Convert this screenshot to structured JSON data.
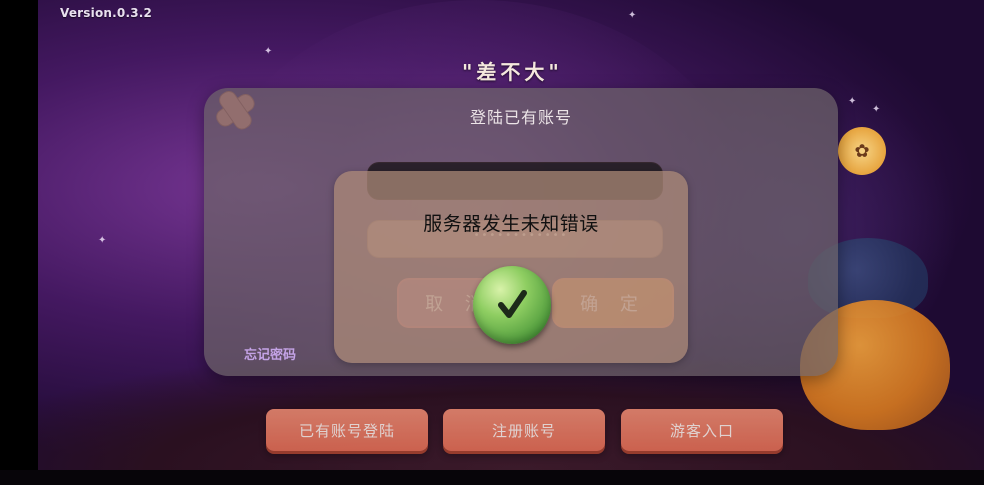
{
  "game": {
    "version": "Version.0.3.2",
    "title_deco": "\"差不大\""
  },
  "login_dialog": {
    "title": "登陆已有账号",
    "password_mask": "••••••••••••",
    "cancel_label": "取 消",
    "confirm_label": "确 定",
    "forgot_label": "忘记密码"
  },
  "error_toast": {
    "message": "服务器发生未知错误"
  },
  "bottom_menu": {
    "login_label": "已有账号登陆",
    "register_label": "注册账号",
    "guest_label": "游客入口"
  },
  "colors": {
    "accent_button": "#e66f56",
    "confirm_green": "#4f9b3c",
    "forgot_link": "#c4a3e6"
  },
  "icons": {
    "confirm": "check-icon",
    "decor_left": "bandage-icon",
    "decor_right": "sun-icon"
  }
}
